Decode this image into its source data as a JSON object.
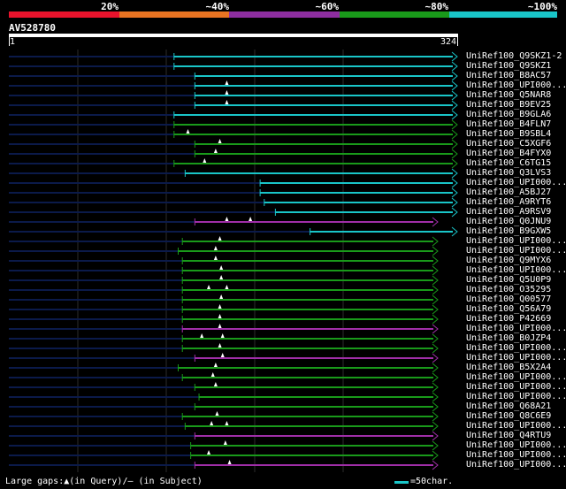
{
  "scale": {
    "labels": [
      "20%",
      "~40%",
      "~60%",
      "~80%",
      "~100%"
    ],
    "colors": [
      "#e8132c",
      "#e87422",
      "#8e2ea0",
      "#199a1a",
      "#19c5c8"
    ]
  },
  "query": {
    "name": "AV528780",
    "start": "1",
    "end": "324",
    "length": 324
  },
  "legend": {
    "text": "Large gaps:▲(in Query)/– (in Subject)",
    "unit": "=50char."
  },
  "colors": {
    "cyan": "#19c5c8",
    "green": "#199a1a",
    "purple": "#a02ea8",
    "navy": "#0b1a4a",
    "grid": "#2d2d2d"
  },
  "hits": [
    {
      "label": "UniRef100_Q9SKZ1-2",
      "start": 120,
      "end": 324,
      "color": "cyan",
      "tri": []
    },
    {
      "label": "UniRef100_Q9SKZ1",
      "start": 120,
      "end": 324,
      "color": "cyan",
      "tri": []
    },
    {
      "label": "UniRef100_B8AC57",
      "start": 135,
      "end": 324,
      "color": "cyan",
      "tri": []
    },
    {
      "label": "UniRef100_UPI000...",
      "start": 135,
      "end": 324,
      "color": "cyan",
      "tri": [
        158
      ]
    },
    {
      "label": "UniRef100_Q5NAR8",
      "start": 135,
      "end": 324,
      "color": "cyan",
      "tri": [
        158
      ]
    },
    {
      "label": "UniRef100_B9EV25",
      "start": 135,
      "end": 324,
      "color": "cyan",
      "tri": [
        158
      ]
    },
    {
      "label": "UniRef100_B9GLA6",
      "start": 120,
      "end": 324,
      "color": "cyan",
      "tri": []
    },
    {
      "label": "UniRef100_B4FLN7",
      "start": 120,
      "end": 324,
      "color": "green",
      "tri": []
    },
    {
      "label": "UniRef100_B9SBL4",
      "start": 120,
      "end": 324,
      "color": "green",
      "tri": [
        130
      ]
    },
    {
      "label": "UniRef100_C5XGF6",
      "start": 135,
      "end": 324,
      "color": "green",
      "tri": [
        153
      ]
    },
    {
      "label": "UniRef100_B4FYX0",
      "start": 135,
      "end": 324,
      "color": "green",
      "tri": [
        150
      ]
    },
    {
      "label": "UniRef100_C6TG15",
      "start": 120,
      "end": 324,
      "color": "green",
      "tri": [
        142
      ]
    },
    {
      "label": "UniRef100_Q3LVS3",
      "start": 128,
      "end": 324,
      "color": "cyan",
      "tri": []
    },
    {
      "label": "UniRef100_UPI000...",
      "start": 182,
      "end": 324,
      "color": "cyan",
      "tri": []
    },
    {
      "label": "UniRef100_A5BJ27",
      "start": 182,
      "end": 324,
      "color": "cyan",
      "tri": []
    },
    {
      "label": "UniRef100_A9RYT6",
      "start": 185,
      "end": 324,
      "color": "cyan",
      "tri": []
    },
    {
      "label": "UniRef100_A9RSV9",
      "start": 193,
      "end": 324,
      "color": "cyan",
      "tri": []
    },
    {
      "label": "UniRef100_Q0JNU9",
      "start": 135,
      "end": 310,
      "color": "purple",
      "tri": [
        158,
        175
      ]
    },
    {
      "label": "UniRef100_B9GXW5",
      "start": 218,
      "end": 324,
      "color": "cyan",
      "tri": []
    },
    {
      "label": "UniRef100_UPI000...",
      "start": 126,
      "end": 310,
      "color": "green",
      "tri": [
        153
      ]
    },
    {
      "label": "UniRef100_UPI000...",
      "start": 123,
      "end": 310,
      "color": "green",
      "tri": [
        150
      ]
    },
    {
      "label": "UniRef100_Q9MYX6",
      "start": 126,
      "end": 310,
      "color": "green",
      "tri": [
        150
      ]
    },
    {
      "label": "UniRef100_UPI000...",
      "start": 126,
      "end": 310,
      "color": "green",
      "tri": [
        154
      ]
    },
    {
      "label": "UniRef100_Q5U0P9",
      "start": 126,
      "end": 310,
      "color": "green",
      "tri": [
        154
      ]
    },
    {
      "label": "UniRef100_O35295",
      "start": 126,
      "end": 310,
      "color": "green",
      "tri": [
        145,
        158
      ]
    },
    {
      "label": "UniRef100_Q00577",
      "start": 126,
      "end": 310,
      "color": "green",
      "tri": [
        154
      ]
    },
    {
      "label": "UniRef100_Q56A79",
      "start": 126,
      "end": 310,
      "color": "green",
      "tri": [
        153
      ]
    },
    {
      "label": "UniRef100_P42669",
      "start": 126,
      "end": 310,
      "color": "green",
      "tri": [
        153
      ]
    },
    {
      "label": "UniRef100_UPI000...",
      "start": 126,
      "end": 310,
      "color": "purple",
      "tri": [
        153
      ]
    },
    {
      "label": "UniRef100_B0JZP4",
      "start": 126,
      "end": 310,
      "color": "green",
      "tri": [
        140,
        155
      ]
    },
    {
      "label": "UniRef100_UPI000...",
      "start": 126,
      "end": 310,
      "color": "green",
      "tri": [
        153
      ]
    },
    {
      "label": "UniRef100_UPI000...",
      "start": 135,
      "end": 310,
      "color": "purple",
      "tri": [
        155
      ]
    },
    {
      "label": "UniRef100_B5X2A4",
      "start": 123,
      "end": 310,
      "color": "green",
      "tri": [
        150
      ]
    },
    {
      "label": "UniRef100_UPI000...",
      "start": 126,
      "end": 310,
      "color": "green",
      "tri": [
        148
      ]
    },
    {
      "label": "UniRef100_UPI000...",
      "start": 135,
      "end": 310,
      "color": "green",
      "tri": [
        150
      ]
    },
    {
      "label": "UniRef100_UPI000...",
      "start": 138,
      "end": 310,
      "color": "green",
      "tri": []
    },
    {
      "label": "UniRef100_Q68A21",
      "start": 135,
      "end": 310,
      "color": "green",
      "tri": []
    },
    {
      "label": "UniRef100_Q8C6E9",
      "start": 126,
      "end": 310,
      "color": "green",
      "tri": [
        151
      ]
    },
    {
      "label": "UniRef100_UPI000...",
      "start": 128,
      "end": 310,
      "color": "green",
      "tri": [
        147,
        158
      ]
    },
    {
      "label": "UniRef100_Q4RTU9",
      "start": 135,
      "end": 310,
      "color": "purple",
      "tri": []
    },
    {
      "label": "UniRef100_UPI000...",
      "start": 132,
      "end": 310,
      "color": "green",
      "tri": [
        157
      ]
    },
    {
      "label": "UniRef100_UPI000...",
      "start": 132,
      "end": 310,
      "color": "green",
      "tri": [
        145
      ]
    },
    {
      "label": "UniRef100_UPI000...",
      "start": 135,
      "end": 310,
      "color": "purple",
      "tri": [
        160
      ]
    }
  ]
}
